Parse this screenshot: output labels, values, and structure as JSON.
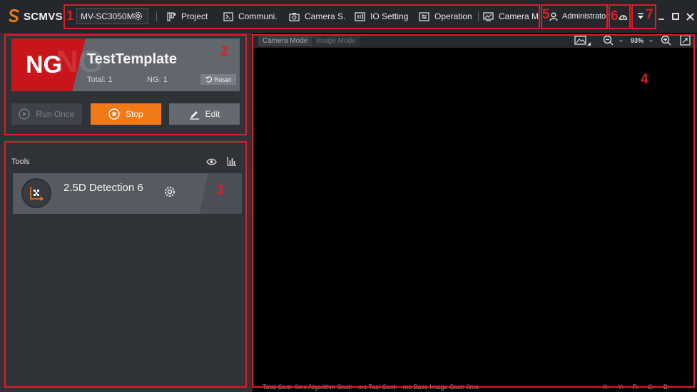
{
  "app": {
    "name": "SCMVS"
  },
  "toolbar": {
    "device": "MV-SC3050M",
    "menu": [
      "Project",
      "Communi.",
      "Camera S.",
      "IO Setting",
      "Operation",
      "Camera M"
    ],
    "user": "Administrator"
  },
  "result": {
    "status": "NG",
    "template": "TestTemplate",
    "total": "Total: 1",
    "ng": "NG: 1",
    "reset": "Reset"
  },
  "actions": {
    "run_once": "Run Once",
    "stop": "Stop",
    "edit": "Edit"
  },
  "tools": {
    "label": "Tools",
    "items": [
      {
        "name": "2.5D Detection 6"
      }
    ]
  },
  "viewer": {
    "tabs": [
      "Camera Mode",
      "Image Mode"
    ],
    "zoom": "93%"
  },
  "statusbar": {
    "costs": "Total Cost: 0ms   Algorithm Cost: --ms   Tool Cost: --ms   Base Image Cost: 0ms",
    "coords": "X: Y: R: G: B:"
  },
  "annotations": [
    "1",
    "2",
    "3",
    "4",
    "5",
    "6",
    "7"
  ],
  "colors": {
    "annotation": "#e01c24",
    "accent": "#f07a18",
    "ng": "#c8151b"
  }
}
